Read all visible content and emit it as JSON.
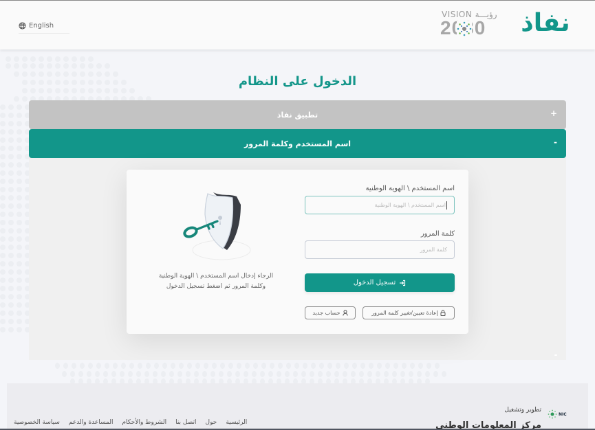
{
  "header": {
    "language_label": "English",
    "vision_top": "VISION رؤيـــة",
    "vision_number": "2030",
    "brand_logo_text": "نفاذ"
  },
  "page": {
    "title": "الدخول على النظام"
  },
  "accordion": [
    {
      "label": "تطبيق نفاذ",
      "toggle": "+",
      "expanded": false
    },
    {
      "label": "اسم المستخدم وكلمة المرور",
      "toggle": "-",
      "expanded": true
    }
  ],
  "form": {
    "username_label": "اسم المستخدم \\ الهوية الوطنية",
    "username_placeholder": "اسم المستخدم \\ الهوية الوطنية",
    "username_value": "",
    "password_label": "كلمة المرور",
    "password_placeholder": "كلمة المرور",
    "password_value": "",
    "login_button": "تسجيل الدخول",
    "reset_password_button": "إعادة تعيين/تغيير كلمة المرور",
    "new_account_button": "حساب جديد",
    "help_text_line1": "الرجاء إدخال اسم المستخدم \\ الهوية الوطنية",
    "help_text_line2": "وكلمة المرور ثم اضغط تسجيل الدخول"
  },
  "footer": {
    "developed_by": "تطوير وتشغيل",
    "nic_logo_text": "NIC",
    "nic_name": "مركز المعلومات الوطني",
    "links": [
      "الرئيسية",
      "حول",
      "اتصل بنا",
      "الشروط والأحكام",
      "المساعدة والدعم",
      "سياسة الخصوصية"
    ]
  },
  "colors": {
    "brand": "#12968a",
    "accordion_inactive": "#c3c3c3",
    "background": "#f4f5f9"
  }
}
